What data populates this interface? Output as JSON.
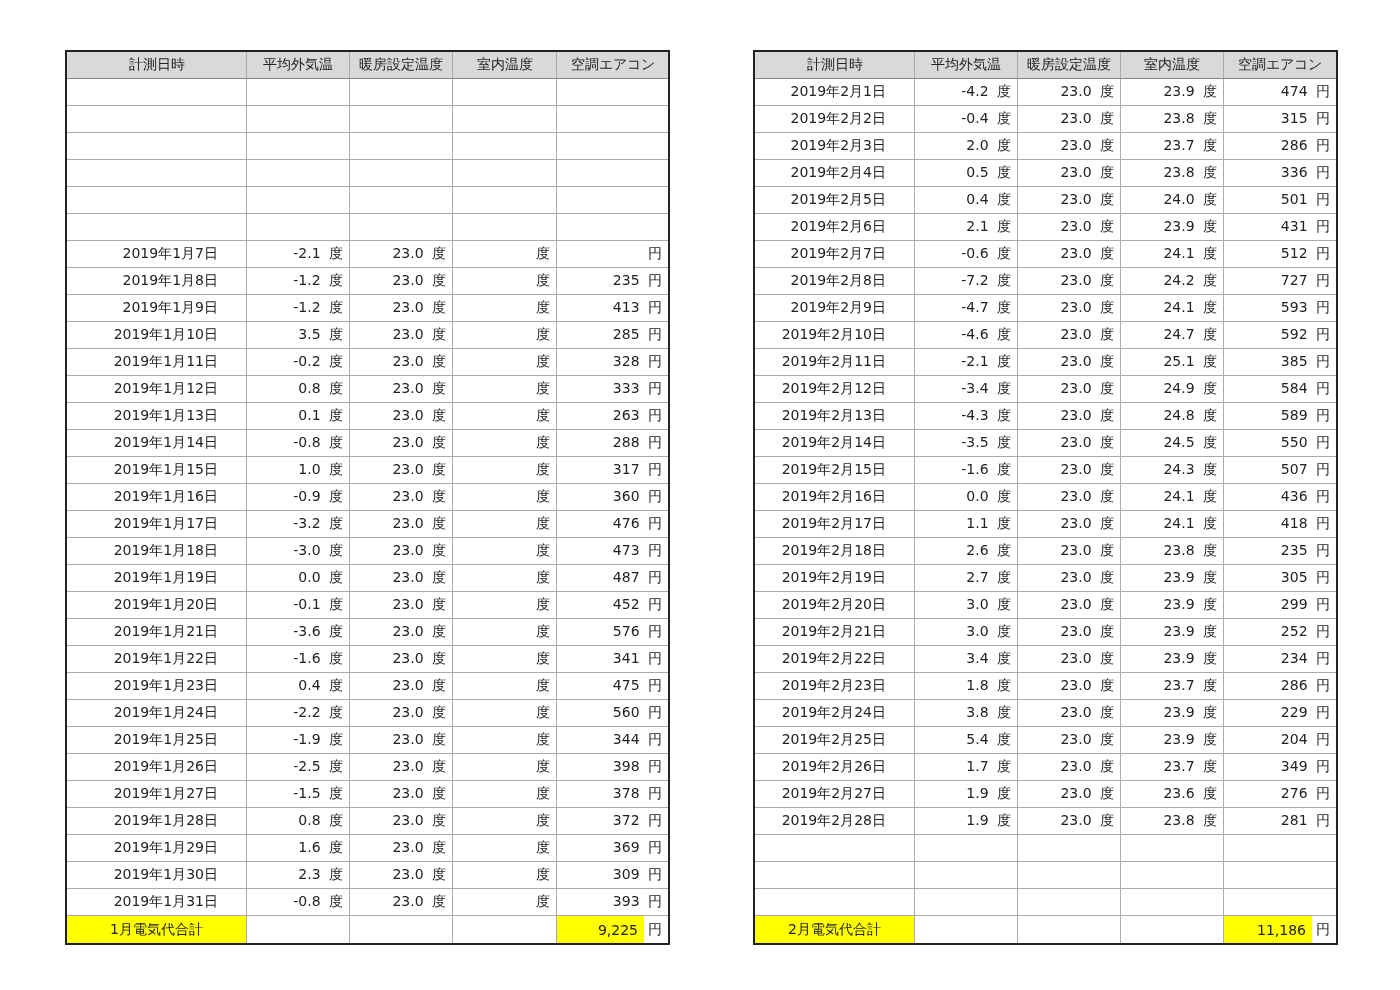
{
  "tables": [
    {
      "columns": [
        "計測日時",
        "平均外気温",
        "暖房設定温度",
        "室内温度",
        "空調エアコン"
      ],
      "rows": [
        {
          "kind": "blank"
        },
        {
          "kind": "blank"
        },
        {
          "kind": "blank"
        },
        {
          "kind": "blank"
        },
        {
          "kind": "blank"
        },
        {
          "kind": "blank"
        },
        {
          "kind": "data",
          "cells": [
            "2019年1月7日",
            "-2.1 度",
            "23.0 度",
            "度",
            "円"
          ]
        },
        {
          "kind": "data",
          "cells": [
            "2019年1月8日",
            "-1.2 度",
            "23.0 度",
            "度",
            "235 円"
          ]
        },
        {
          "kind": "data",
          "cells": [
            "2019年1月9日",
            "-1.2 度",
            "23.0 度",
            "度",
            "413 円"
          ]
        },
        {
          "kind": "data",
          "cells": [
            "2019年1月10日",
            "3.5 度",
            "23.0 度",
            "度",
            "285 円"
          ]
        },
        {
          "kind": "data",
          "cells": [
            "2019年1月11日",
            "-0.2 度",
            "23.0 度",
            "度",
            "328 円"
          ]
        },
        {
          "kind": "data",
          "cells": [
            "2019年1月12日",
            "0.8 度",
            "23.0 度",
            "度",
            "333 円"
          ]
        },
        {
          "kind": "data",
          "cells": [
            "2019年1月13日",
            "0.1 度",
            "23.0 度",
            "度",
            "263 円"
          ]
        },
        {
          "kind": "data",
          "cells": [
            "2019年1月14日",
            "-0.8 度",
            "23.0 度",
            "度",
            "288 円"
          ]
        },
        {
          "kind": "data",
          "cells": [
            "2019年1月15日",
            "1.0 度",
            "23.0 度",
            "度",
            "317 円"
          ]
        },
        {
          "kind": "data",
          "cells": [
            "2019年1月16日",
            "-0.9 度",
            "23.0 度",
            "度",
            "360 円"
          ]
        },
        {
          "kind": "data",
          "cells": [
            "2019年1月17日",
            "-3.2 度",
            "23.0 度",
            "度",
            "476 円"
          ]
        },
        {
          "kind": "data",
          "cells": [
            "2019年1月18日",
            "-3.0 度",
            "23.0 度",
            "度",
            "473 円"
          ]
        },
        {
          "kind": "data",
          "cells": [
            "2019年1月19日",
            "0.0 度",
            "23.0 度",
            "度",
            "487 円"
          ]
        },
        {
          "kind": "data",
          "cells": [
            "2019年1月20日",
            "-0.1 度",
            "23.0 度",
            "度",
            "452 円"
          ]
        },
        {
          "kind": "data",
          "cells": [
            "2019年1月21日",
            "-3.6 度",
            "23.0 度",
            "度",
            "576 円"
          ]
        },
        {
          "kind": "data",
          "cells": [
            "2019年1月22日",
            "-1.6 度",
            "23.0 度",
            "度",
            "341 円"
          ]
        },
        {
          "kind": "data",
          "cells": [
            "2019年1月23日",
            "0.4 度",
            "23.0 度",
            "度",
            "475 円"
          ]
        },
        {
          "kind": "data",
          "cells": [
            "2019年1月24日",
            "-2.2 度",
            "23.0 度",
            "度",
            "560 円"
          ]
        },
        {
          "kind": "data",
          "cells": [
            "2019年1月25日",
            "-1.9 度",
            "23.0 度",
            "度",
            "344 円"
          ]
        },
        {
          "kind": "data",
          "cells": [
            "2019年1月26日",
            "-2.5 度",
            "23.0 度",
            "度",
            "398 円"
          ]
        },
        {
          "kind": "data",
          "cells": [
            "2019年1月27日",
            "-1.5 度",
            "23.0 度",
            "度",
            "378 円"
          ]
        },
        {
          "kind": "data",
          "cells": [
            "2019年1月28日",
            "0.8 度",
            "23.0 度",
            "度",
            "372 円"
          ]
        },
        {
          "kind": "data",
          "cells": [
            "2019年1月29日",
            "1.6 度",
            "23.0 度",
            "度",
            "369 円"
          ]
        },
        {
          "kind": "data",
          "cells": [
            "2019年1月30日",
            "2.3 度",
            "23.0 度",
            "度",
            "309 円"
          ]
        },
        {
          "kind": "data",
          "cells": [
            "2019年1月31日",
            "-0.8 度",
            "23.0 度",
            "度",
            "393 円"
          ]
        }
      ],
      "total": {
        "label": "1月電気代合計",
        "amount": "9,225",
        "unit": "円"
      }
    },
    {
      "columns": [
        "計測日時",
        "平均外気温",
        "暖房設定温度",
        "室内温度",
        "空調エアコン"
      ],
      "rows": [
        {
          "kind": "data",
          "cells": [
            "2019年2月1日",
            "-4.2 度",
            "23.0 度",
            "23.9 度",
            "474 円"
          ]
        },
        {
          "kind": "data",
          "cells": [
            "2019年2月2日",
            "-0.4 度",
            "23.0 度",
            "23.8 度",
            "315 円"
          ]
        },
        {
          "kind": "data",
          "cells": [
            "2019年2月3日",
            "2.0 度",
            "23.0 度",
            "23.7 度",
            "286 円"
          ]
        },
        {
          "kind": "data",
          "cells": [
            "2019年2月4日",
            "0.5 度",
            "23.0 度",
            "23.8 度",
            "336 円"
          ]
        },
        {
          "kind": "data",
          "cells": [
            "2019年2月5日",
            "0.4 度",
            "23.0 度",
            "24.0 度",
            "501 円"
          ]
        },
        {
          "kind": "data",
          "cells": [
            "2019年2月6日",
            "2.1 度",
            "23.0 度",
            "23.9 度",
            "431 円"
          ]
        },
        {
          "kind": "data",
          "cells": [
            "2019年2月7日",
            "-0.6 度",
            "23.0 度",
            "24.1 度",
            "512 円"
          ]
        },
        {
          "kind": "data",
          "cells": [
            "2019年2月8日",
            "-7.2 度",
            "23.0 度",
            "24.2 度",
            "727 円"
          ]
        },
        {
          "kind": "data",
          "cells": [
            "2019年2月9日",
            "-4.7 度",
            "23.0 度",
            "24.1 度",
            "593 円"
          ]
        },
        {
          "kind": "data",
          "cells": [
            "2019年2月10日",
            "-4.6 度",
            "23.0 度",
            "24.7 度",
            "592 円"
          ]
        },
        {
          "kind": "data",
          "cells": [
            "2019年2月11日",
            "-2.1 度",
            "23.0 度",
            "25.1 度",
            "385 円"
          ]
        },
        {
          "kind": "data",
          "cells": [
            "2019年2月12日",
            "-3.4 度",
            "23.0 度",
            "24.9 度",
            "584 円"
          ]
        },
        {
          "kind": "data",
          "cells": [
            "2019年2月13日",
            "-4.3 度",
            "23.0 度",
            "24.8 度",
            "589 円"
          ]
        },
        {
          "kind": "data",
          "cells": [
            "2019年2月14日",
            "-3.5 度",
            "23.0 度",
            "24.5 度",
            "550 円"
          ]
        },
        {
          "kind": "data",
          "cells": [
            "2019年2月15日",
            "-1.6 度",
            "23.0 度",
            "24.3 度",
            "507 円"
          ]
        },
        {
          "kind": "data",
          "cells": [
            "2019年2月16日",
            "0.0 度",
            "23.0 度",
            "24.1 度",
            "436 円"
          ]
        },
        {
          "kind": "data",
          "cells": [
            "2019年2月17日",
            "1.1 度",
            "23.0 度",
            "24.1 度",
            "418 円"
          ]
        },
        {
          "kind": "data",
          "cells": [
            "2019年2月18日",
            "2.6 度",
            "23.0 度",
            "23.8 度",
            "235 円"
          ]
        },
        {
          "kind": "data",
          "cells": [
            "2019年2月19日",
            "2.7 度",
            "23.0 度",
            "23.9 度",
            "305 円"
          ]
        },
        {
          "kind": "data",
          "cells": [
            "2019年2月20日",
            "3.0 度",
            "23.0 度",
            "23.9 度",
            "299 円"
          ]
        },
        {
          "kind": "data",
          "cells": [
            "2019年2月21日",
            "3.0 度",
            "23.0 度",
            "23.9 度",
            "252 円"
          ]
        },
        {
          "kind": "data",
          "cells": [
            "2019年2月22日",
            "3.4 度",
            "23.0 度",
            "23.9 度",
            "234 円"
          ]
        },
        {
          "kind": "data",
          "cells": [
            "2019年2月23日",
            "1.8 度",
            "23.0 度",
            "23.7 度",
            "286 円"
          ]
        },
        {
          "kind": "data",
          "cells": [
            "2019年2月24日",
            "3.8 度",
            "23.0 度",
            "23.9 度",
            "229 円"
          ]
        },
        {
          "kind": "data",
          "cells": [
            "2019年2月25日",
            "5.4 度",
            "23.0 度",
            "23.9 度",
            "204 円"
          ]
        },
        {
          "kind": "data",
          "cells": [
            "2019年2月26日",
            "1.7 度",
            "23.0 度",
            "23.7 度",
            "349 円"
          ]
        },
        {
          "kind": "data",
          "cells": [
            "2019年2月27日",
            "1.9 度",
            "23.0 度",
            "23.6 度",
            "276 円"
          ]
        },
        {
          "kind": "data",
          "cells": [
            "2019年2月28日",
            "1.9 度",
            "23.0 度",
            "23.8 度",
            "281 円"
          ]
        },
        {
          "kind": "blank"
        },
        {
          "kind": "blank"
        },
        {
          "kind": "blank"
        }
      ],
      "total": {
        "label": "2月電気代合計",
        "amount": "11,186",
        "unit": "円"
      }
    }
  ]
}
